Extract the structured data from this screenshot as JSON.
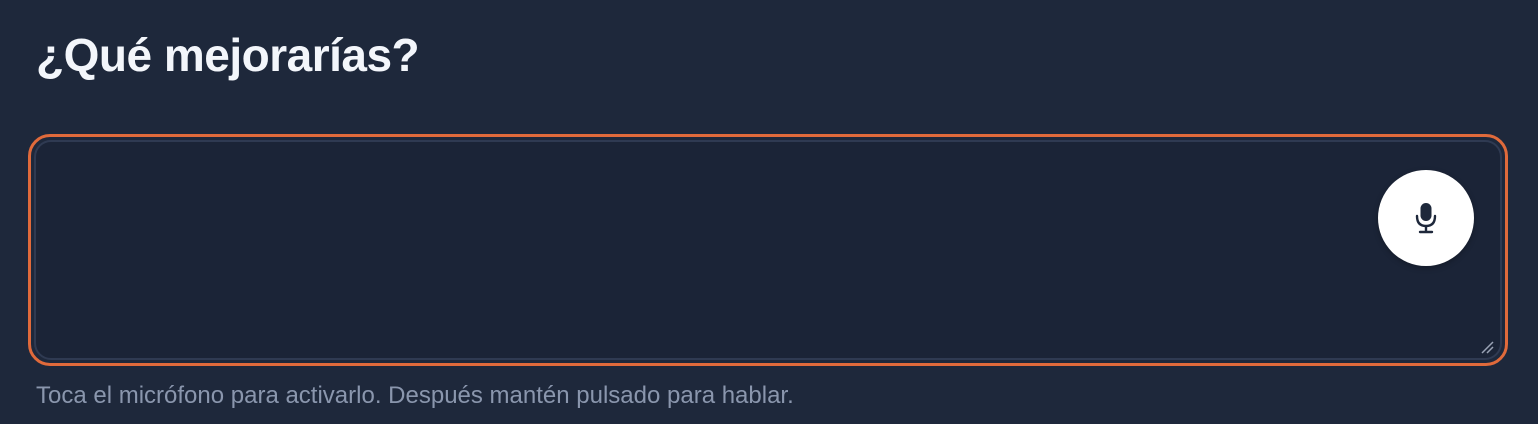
{
  "form": {
    "title": "¿Qué mejorarías?",
    "textarea": {
      "value": "",
      "placeholder": ""
    },
    "mic_button": {
      "icon": "microphone-icon"
    },
    "helper_text": "Toca el micrófono para activarlo. Después mantén pulsado para hablar."
  },
  "colors": {
    "background": "#1e283b",
    "field_background": "#1b2437",
    "focus_ring": "#e06a3b",
    "mic_button_background": "#ffffff",
    "mic_icon": "#1e283b",
    "title_text": "#f3f6fb",
    "helper_text": "#8a96ad"
  }
}
